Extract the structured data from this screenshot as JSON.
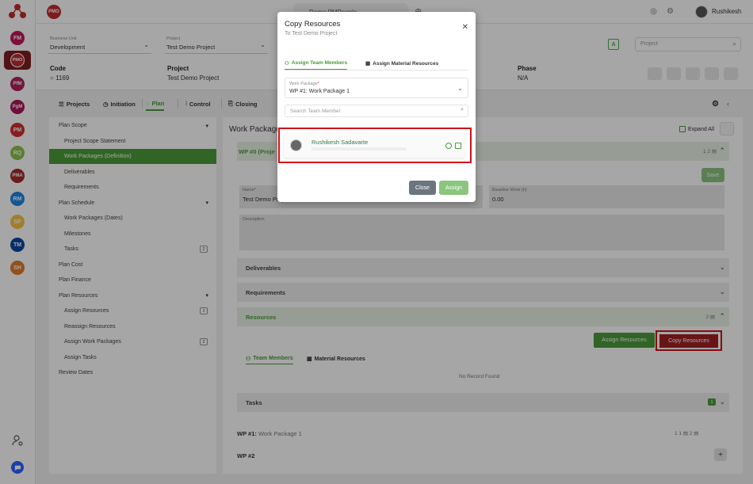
{
  "browser": {
    "tab_title": "Demo PMPeople"
  },
  "topbar": {
    "badge": "PMO",
    "user_name": "Rushikesh"
  },
  "rail": {
    "items": [
      {
        "label": "FM",
        "color": "#c2185b"
      },
      {
        "label": "PMO",
        "color": "#c12b2d"
      },
      {
        "label": "PfM",
        "color": "#b0245b"
      },
      {
        "label": "PgM",
        "color": "#ad1457"
      },
      {
        "label": "PM",
        "color": "#d32f2f"
      },
      {
        "label": "RQ",
        "color": "#8bc34a"
      },
      {
        "label": "PMA",
        "color": "#a52a2a"
      },
      {
        "label": "RM",
        "color": "#1e88e5"
      },
      {
        "label": "SP",
        "color": "#f6c342"
      },
      {
        "label": "TM",
        "color": "#0d47a1"
      },
      {
        "label": "SH",
        "color": "#e07b2a"
      }
    ]
  },
  "filters": {
    "business_unit": {
      "label": "Business Unit",
      "value": "Development"
    },
    "project": {
      "label": "Project",
      "value": "Test Demo Project"
    },
    "search_placeholder": "Project"
  },
  "info": {
    "code_label": "Code",
    "code_value": "1169",
    "project_label": "Project",
    "project_value": "Test Demo Project",
    "phase_label": "Phase",
    "phase_value": "N/A"
  },
  "nav_tabs": [
    "Projects",
    "Initiation",
    "Plan",
    "Control",
    "Closing"
  ],
  "tree": [
    {
      "label": "Plan Scope",
      "level": 1,
      "caret": "▾"
    },
    {
      "label": "Project Scope Statement",
      "level": 2
    },
    {
      "label": "Work Packages (Definition)",
      "level": 2,
      "active": true
    },
    {
      "label": "Deliverables",
      "level": 2
    },
    {
      "label": "Requirements",
      "level": 2
    },
    {
      "label": "Plan Schedule",
      "level": 1,
      "caret": "▾"
    },
    {
      "label": "Work Packages (Dates)",
      "level": 2
    },
    {
      "label": "Milestones",
      "level": 2
    },
    {
      "label": "Tasks",
      "level": 2,
      "count": "2"
    },
    {
      "label": "Plan Cost",
      "level": 1
    },
    {
      "label": "Plan Finance",
      "level": 1
    },
    {
      "label": "Plan Resources",
      "level": 1,
      "caret": "▾"
    },
    {
      "label": "Assign Resources",
      "level": 2,
      "count": "1"
    },
    {
      "label": "Reassign Resources",
      "level": 2
    },
    {
      "label": "Assign Work Packages",
      "level": 2,
      "count": "2"
    },
    {
      "label": "Assign Tasks",
      "level": 2
    },
    {
      "label": "Review Dates",
      "level": 1
    }
  ],
  "main": {
    "title": "Work Packages",
    "expand_all": "Expand All",
    "wp0_title": "WP #0 (Proje",
    "wp0_meta": "1  2 ▤",
    "save": "Save",
    "name_label": "Name",
    "name_value": "Test Demo Project",
    "baseline_label": "Baseline Work (h)",
    "baseline_value": "0.00",
    "description_label": "Description",
    "sections": {
      "deliverables": "Deliverables",
      "requirements": "Requirements",
      "resources": "Resources",
      "resources_count": "2 ▤",
      "tasks": "Tasks",
      "tasks_badge": "1"
    },
    "assign_resources": "Assign Resources",
    "copy_resources": "Copy Resources",
    "team_members_tab": "Team Members",
    "material_resources_tab": "Material Resources",
    "no_record": "No Record Found",
    "wp1_prefix": "WP #1:",
    "wp1_name": "Work Package 1",
    "wp1_meta": "1  1 ▤  2 ▤",
    "wp2": "WP #2"
  },
  "modal": {
    "title": "Copy Resources",
    "subtitle": "To Test Demo Project",
    "tab_team": "Assign Team Members",
    "tab_material": "Assign Material Resources",
    "wp_label": "Work Package",
    "wp_value": "WP #1: Work Package 1",
    "search_placeholder": "Search Team Member",
    "member_name": "Rushikesh Sadavarte",
    "close": "Close",
    "assign": "Assign"
  }
}
